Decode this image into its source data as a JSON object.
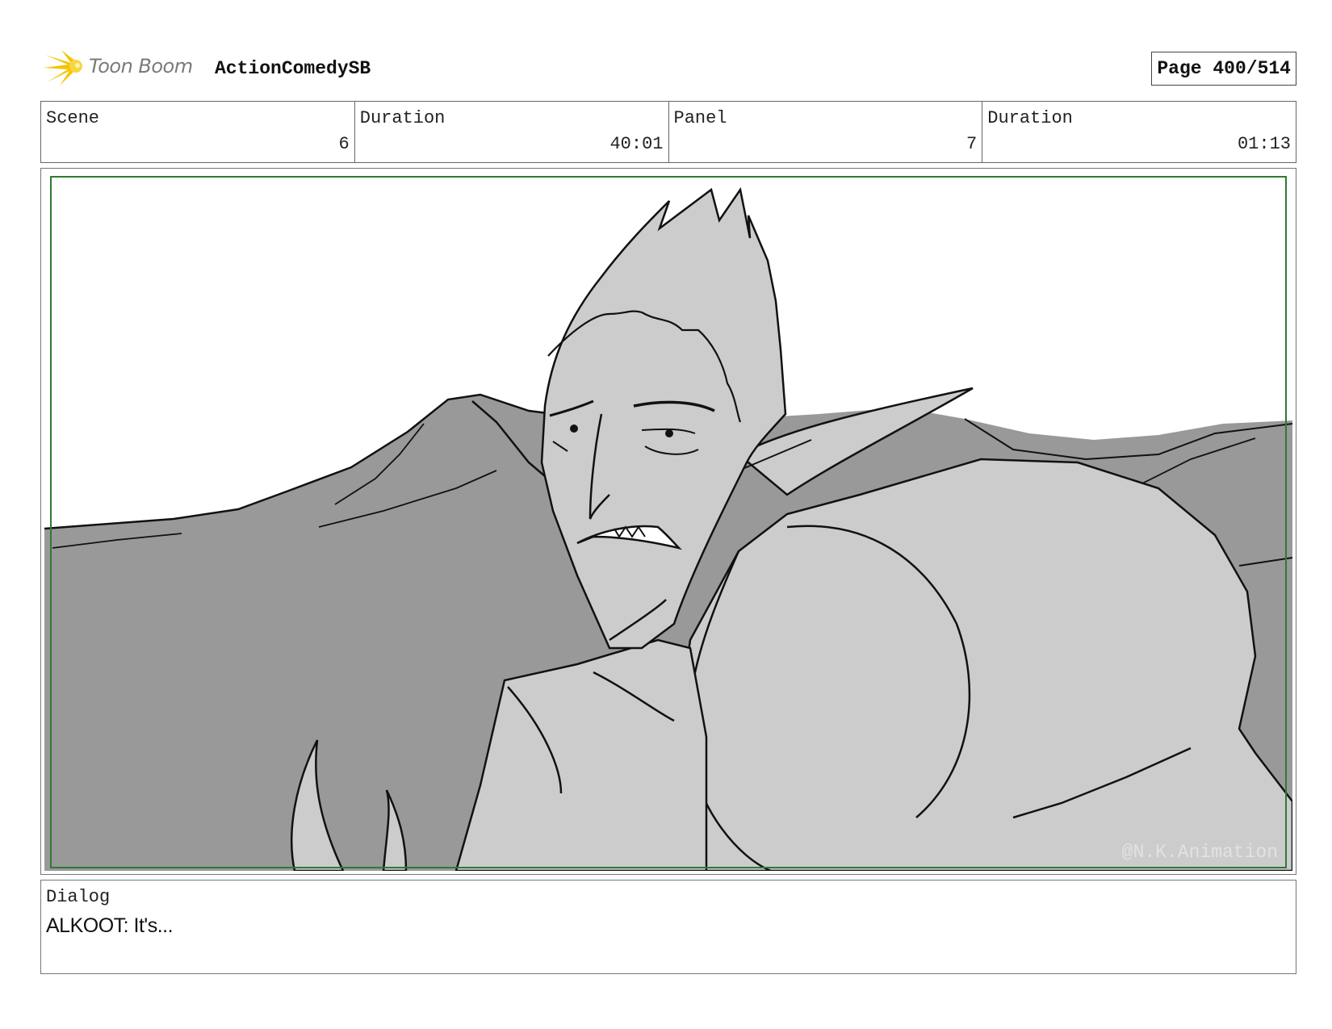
{
  "header": {
    "logo_text": "Toon Boom",
    "project_title": "ActionComedySB",
    "page_label": "Page 400/514"
  },
  "info": {
    "scene_label": "Scene",
    "scene_value": "6",
    "scene_duration_label": "Duration",
    "scene_duration_value": "40:01",
    "panel_label": "Panel",
    "panel_value": "7",
    "panel_duration_label": "Duration",
    "panel_duration_value": "01:13"
  },
  "panel": {
    "watermark": "@N.K.Animation"
  },
  "dialog": {
    "label": "Dialog",
    "text": "ALKOOT: It's..."
  },
  "colors": {
    "safe_frame": "#2f7a2f",
    "ground": "#999999",
    "character_fill": "#cccccc",
    "logo_star": "#f5c400"
  }
}
